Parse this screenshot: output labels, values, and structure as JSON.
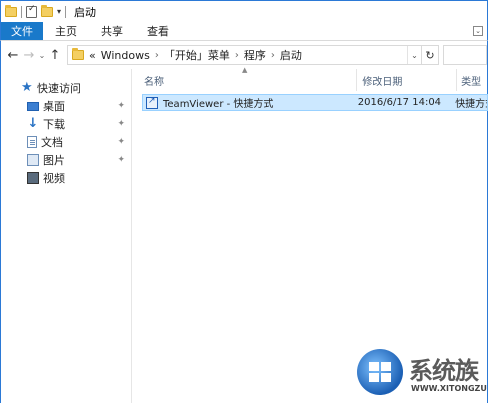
{
  "window": {
    "title": "启动"
  },
  "ribbon": {
    "tabs": [
      "文件",
      "主页",
      "共享",
      "查看"
    ]
  },
  "address": {
    "prefix": "«",
    "path": [
      "Windows",
      "「开始」菜单",
      "程序",
      "启动"
    ]
  },
  "sidebar": {
    "quick_access": "快速访问",
    "items": [
      {
        "label": "桌面",
        "icon": "desktop-icon"
      },
      {
        "label": "下载",
        "icon": "download-icon"
      },
      {
        "label": "文档",
        "icon": "documents-icon"
      },
      {
        "label": "图片",
        "icon": "pictures-icon"
      },
      {
        "label": "视频",
        "icon": "videos-icon"
      }
    ]
  },
  "columns": {
    "name": "名称",
    "date": "修改日期",
    "type": "类型"
  },
  "files": [
    {
      "name": "TeamViewer - 快捷方式",
      "date": "2016/6/17 14:04",
      "type": "快捷方式"
    }
  ],
  "watermark": {
    "text": "系统族",
    "url": "WWW.XITONGZU.COM"
  },
  "colors": {
    "accent": "#1979ca",
    "selection": "#cce8ff"
  }
}
